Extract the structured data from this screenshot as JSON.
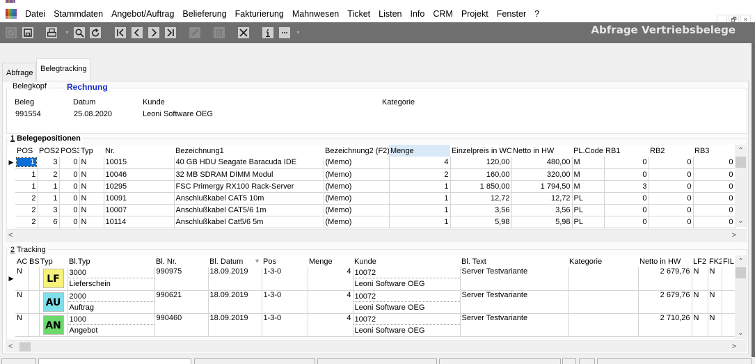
{
  "window": {
    "title_partial": "[...]",
    "caption": "Abfrage Vertriebsbelege",
    "controls": {
      "minimize": "_",
      "restore": "🗗",
      "close": "×"
    }
  },
  "menu": [
    "Datei",
    "Stammdaten",
    "Angebot/Auftrag",
    "Belieferung",
    "Fakturierung",
    "Mahnwesen",
    "Ticket",
    "Listen",
    "Info",
    "CRM",
    "Projekt",
    "Fenster",
    "?"
  ],
  "toolbar": {
    "buttons": [
      {
        "name": "edit",
        "glyph": "✎",
        "enabled": false
      },
      {
        "name": "save",
        "glyph": "🖫",
        "enabled": true
      },
      {
        "name": "print",
        "glyph": "🖶",
        "enabled": true
      },
      {
        "name": "search",
        "glyph": "🔍",
        "enabled": true
      },
      {
        "name": "refresh",
        "glyph": "↻",
        "enabled": true
      },
      {
        "name": "first",
        "glyph": "|<",
        "enabled": true
      },
      {
        "name": "prev",
        "glyph": "<",
        "enabled": true
      },
      {
        "name": "next",
        "glyph": ">",
        "enabled": true
      },
      {
        "name": "last",
        "glyph": ">|",
        "enabled": true
      },
      {
        "name": "pencil",
        "glyph": "✏",
        "enabled": false
      },
      {
        "name": "delete",
        "glyph": "🗑",
        "enabled": false
      },
      {
        "name": "cancel",
        "glyph": "✕",
        "enabled": true
      },
      {
        "name": "info",
        "glyph": "i",
        "enabled": true
      },
      {
        "name": "more",
        "glyph": "···",
        "enabled": true
      }
    ]
  },
  "tabs": [
    {
      "label": "Abfrage",
      "active": false
    },
    {
      "label": "Belegtracking",
      "active": true
    }
  ],
  "belegkopf": {
    "legend": "Belegkopf",
    "doc_type": "Rechnung",
    "labels": {
      "beleg": "Beleg",
      "datum": "Datum",
      "kunde": "Kunde",
      "kategorie": "Kategorie"
    },
    "values": {
      "beleg": "991554",
      "datum": "25.08.2020",
      "kunde": "Leoni Software OEG",
      "kategorie": ""
    }
  },
  "positions": {
    "title_num": "1",
    "title": " Belegepositionen",
    "columns": [
      "POS",
      "POS2",
      "POS3",
      "Typ",
      "Nr.",
      "Bezeichnung1",
      "Bezeichnung2 (F2)",
      "Menge",
      "Einzelpreis in WC",
      "Netto in HW",
      "PL.Code",
      "RB1",
      "RB2",
      "RB3"
    ],
    "rows": [
      [
        "1",
        "3",
        "0",
        "N",
        "10015",
        "40 GB HDU Seagate Baracuda IDE",
        "(Memo)",
        "4",
        "120,00",
        "480,00",
        "M",
        "0",
        "0",
        "0"
      ],
      [
        "1",
        "2",
        "0",
        "N",
        "10046",
        "32 MB SDRAM DIMM Modul",
        "(Memo)",
        "2",
        "160,00",
        "320,00",
        "M",
        "0",
        "0",
        "0"
      ],
      [
        "1",
        "1",
        "0",
        "N",
        "10295",
        "FSC Primergy RX100 Rack-Server",
        "(Memo)",
        "1",
        "1 850,00",
        "1 794,50",
        "M",
        "3",
        "0",
        "0"
      ],
      [
        "2",
        "1",
        "0",
        "N",
        "10091",
        "Anschlußkabel CAT5 10m",
        "(Memo)",
        "1",
        "12,72",
        "12,72",
        "PL",
        "0",
        "0",
        "0"
      ],
      [
        "2",
        "3",
        "0",
        "N",
        "10007",
        "Anschlußkabel CAT5/6 1m",
        "(Memo)",
        "1",
        "3,56",
        "3,56",
        "PL",
        "0",
        "0",
        "0"
      ],
      [
        "2",
        "6",
        "0",
        "N",
        "10114",
        "Anschlußkabel Cat5/6 5m",
        "(Memo)",
        "1",
        "5,98",
        "5,98",
        "PL",
        "0",
        "0",
        "0"
      ]
    ],
    "current_row": 0
  },
  "tracking": {
    "title_num": "2",
    "title": " Tracking",
    "columns": [
      "AC",
      "BS",
      "Typ",
      "Bl.Typ",
      "Bl. Nr.",
      "Bl. Datum",
      "Pos",
      "Menge",
      "Kunde",
      "Bl. Text",
      "Kategorie",
      "Netto in HW",
      "LF2",
      "FK2",
      "FIL"
    ],
    "sort_indicator": "▼",
    "rows": [
      {
        "ac": "N",
        "bs": "",
        "typ_badge": "LF",
        "badge_color": "#f7f27a",
        "bltyp_code": "3000",
        "bltyp_name": "Lieferschein",
        "blnr": "990975",
        "datum": "18.09.2019",
        "pos": "1-3-0",
        "menge": "4",
        "kunde_nr": "10072",
        "kunde_name": "Leoni Software OEG",
        "bltext": "Server Testvariante",
        "kategorie": "",
        "netto": "2 679,76",
        "lf2": "N",
        "fk2": "N",
        "fil": ""
      },
      {
        "ac": "N",
        "bs": "",
        "typ_badge": "AU",
        "badge_color": "#7fe0ea",
        "bltyp_code": "2000",
        "bltyp_name": "Auftrag",
        "blnr": "990621",
        "datum": "18.09.2019",
        "pos": "1-3-0",
        "menge": "4",
        "kunde_nr": "10072",
        "kunde_name": "Leoni Software OEG",
        "bltext": "Server Testvariante",
        "kategorie": "",
        "netto": "2 679,76",
        "lf2": "N",
        "fk2": "N",
        "fil": ""
      },
      {
        "ac": "N",
        "bs": "",
        "typ_badge": "AN",
        "badge_color": "#6cd96c",
        "bltyp_code": "1000",
        "bltyp_name": "Angebot",
        "blnr": "990460",
        "datum": "18.09.2019",
        "pos": "1-3-0",
        "menge": "4",
        "kunde_nr": "10072",
        "kunde_name": "Leoni Software OEG",
        "bltext": "Server Testvariante",
        "kategorie": "",
        "netto": "2 710,26",
        "lf2": "N",
        "fk2": "N",
        "fil": ""
      }
    ]
  },
  "colors": {
    "toolbar_bg": "#6f6f6f",
    "selection": "#0a6fd6",
    "doc_type_text": "#1a2ec8",
    "header_highlight": "#d9e9f8"
  }
}
